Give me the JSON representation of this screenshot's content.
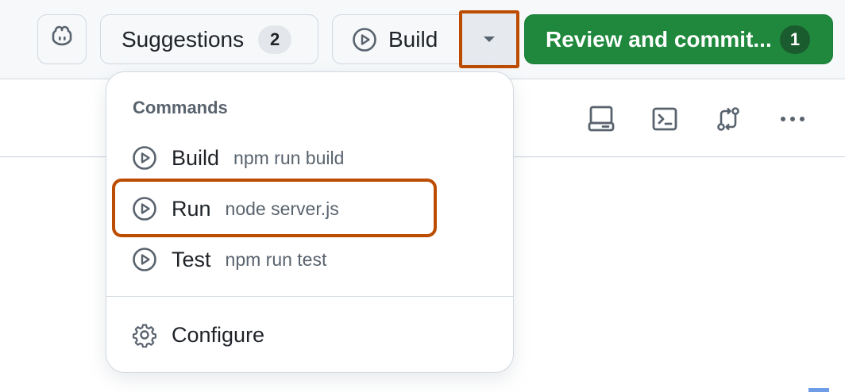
{
  "toolbar": {
    "copilot_icon": "copilot-icon",
    "suggestions_label": "Suggestions",
    "suggestions_count": "2",
    "build_label": "Build",
    "commit_label": "Review and commit...",
    "commit_count": "1"
  },
  "menu": {
    "heading": "Commands",
    "items": [
      {
        "label": "Build",
        "command": "npm run build",
        "icon": "play-icon"
      },
      {
        "label": "Run",
        "command": "node server.js",
        "icon": "play-icon"
      },
      {
        "label": "Test",
        "command": "npm run test",
        "icon": "play-icon"
      }
    ],
    "configure_label": "Configure",
    "configure_icon": "gear-icon"
  },
  "subbar_icons": [
    "device-desktop-icon",
    "terminal-icon",
    "git-compare-icon",
    "kebab-horizontal-icon"
  ],
  "colors": {
    "accent_highlight": "#bc4c00",
    "primary_green": "#1f883d"
  }
}
